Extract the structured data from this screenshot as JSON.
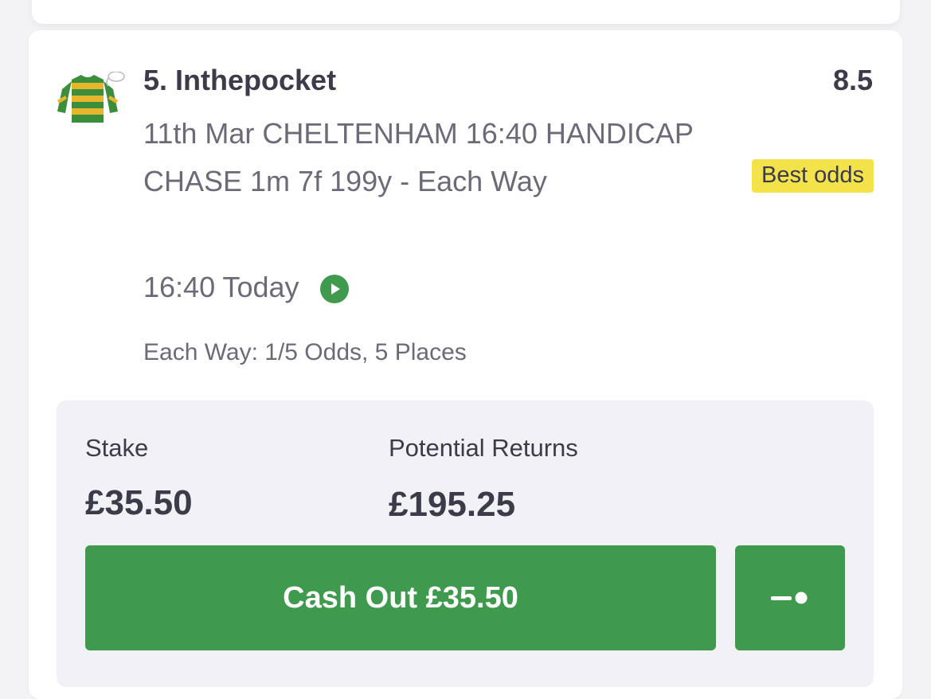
{
  "selection": {
    "name": "5. Inthepocket",
    "odds": "8.5",
    "best_odds_label": "Best odds",
    "market": "11th Mar CHELTENHAM 16:40 HANDICAP CHASE 1m 7f 199y - Each Way",
    "race_time": "16:40 Today",
    "each_way_terms": "Each Way: 1/5 Odds, 5 Places",
    "silks_icon": "jockey-silks-icon",
    "play_icon": "play-circle-icon"
  },
  "stake_panel": {
    "stake_label": "Stake",
    "stake_value": "£35.50",
    "returns_label": "Potential Returns",
    "returns_value": "£195.25",
    "cashout_label": "Cash Out £35.50",
    "partial_cashout_icon": "slider-toggle-icon"
  },
  "colors": {
    "accent_green": "#3f9a4d",
    "badge_yellow": "#f4e24a",
    "text_dark": "#3b3b4a",
    "text_muted": "#6b6b78",
    "panel_bg": "#f1f1f6"
  }
}
